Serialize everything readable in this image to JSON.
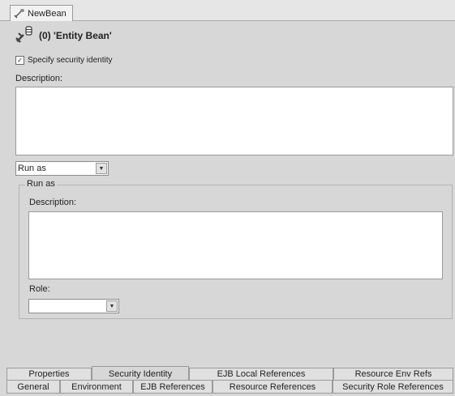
{
  "editor": {
    "tab_label": "NewBean"
  },
  "header": {
    "title": "(0) 'Entity Bean'"
  },
  "security_identity": {
    "checkbox_label": "Specify security identity",
    "checked": true,
    "description_label": "Description:",
    "description_value": "",
    "mode_select_value": "Run as"
  },
  "run_as": {
    "group_title": "Run as",
    "description_label": "Description:",
    "description_value": "",
    "role_label": "Role:",
    "role_value": ""
  },
  "tabs_top": [
    "Properties",
    "Security Identity",
    "EJB Local References",
    "Resource Env Refs"
  ],
  "tabs_bottom": [
    "General",
    "Environment",
    "EJB References",
    "Resource References",
    "Security Role References"
  ],
  "active_tab": "Security Identity"
}
